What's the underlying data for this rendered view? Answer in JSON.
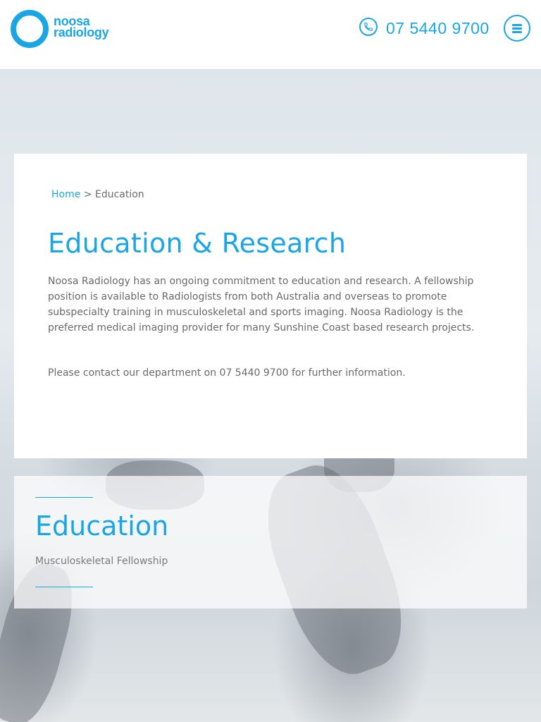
{
  "header": {
    "logo_line1": "noosa",
    "logo_line2": "radiology",
    "phone": "07 5440 9700",
    "colors": {
      "accent": "#1aa6e4"
    },
    "icons": {
      "phone": "phone-icon",
      "menu": "hamburger-menu-icon"
    }
  },
  "breadcrumb": {
    "home": "Home",
    "separator": ">",
    "current": "Education"
  },
  "main": {
    "title": "Education & Research",
    "paragraphs": [
      "Noosa Radiology has an ongoing commitment to education and research. A fellowship position is available to Radiologists from both Australia and overseas to promote subspecialty training in musculoskeletal and sports imaging. Noosa Radiology is the preferred medical imaging provider for many Sunshine Coast based research projects.",
      "Please contact our department on 07 5440 9700 for further information."
    ]
  },
  "section": {
    "title": "Education",
    "links": [
      "Musculoskeletal Fellowship"
    ]
  }
}
